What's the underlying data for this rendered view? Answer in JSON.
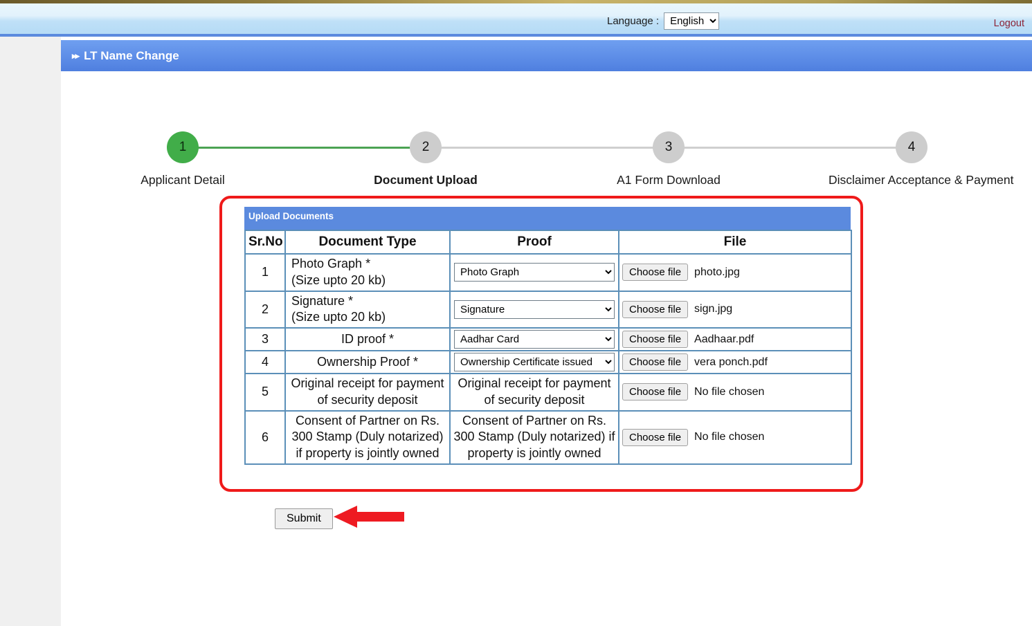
{
  "topbar": {
    "language_label": "Language :",
    "language_value": "English",
    "language_options": [
      "English"
    ],
    "logout_label": "Logout"
  },
  "page_heading": {
    "bullet": "▸▸",
    "title": "LT Name Change"
  },
  "stepper": {
    "steps": [
      {
        "number": "1",
        "label": "Applicant Detail",
        "state": "done"
      },
      {
        "number": "2",
        "label": "Document Upload",
        "state": "current"
      },
      {
        "number": "3",
        "label": "A1 Form Download",
        "state": "pending"
      },
      {
        "number": "4",
        "label": "Disclaimer Acceptance & Payment",
        "state": "pending"
      }
    ]
  },
  "upload_table": {
    "caption": "Upload Documents",
    "columns": [
      "Sr.No",
      "Document Type",
      "Proof",
      "File"
    ],
    "rows": [
      {
        "sr": "1",
        "doc_type": "Photo Graph *\n(Size upto 20 kb)",
        "doc_type_line1": "Photo Graph *",
        "doc_type_line2": "(Size upto 20 kb)",
        "proof_kind": "select",
        "proof_value": "Photo Graph",
        "choose_label": "Choose file",
        "file_name": "photo.jpg"
      },
      {
        "sr": "2",
        "doc_type_line1": "Signature *",
        "doc_type_line2": "(Size upto 20 kb)",
        "proof_kind": "select",
        "proof_value": "Signature",
        "choose_label": "Choose file",
        "file_name": "sign.jpg"
      },
      {
        "sr": "3",
        "doc_type_line1": "ID proof *",
        "doc_type_line2": "",
        "proof_kind": "select",
        "proof_value": "Aadhar Card",
        "choose_label": "Choose file",
        "file_name": "Aadhaar.pdf"
      },
      {
        "sr": "4",
        "doc_type_line1": "Ownership Proof *",
        "doc_type_line2": "",
        "proof_kind": "select",
        "proof_value": "Ownership Certificate issued",
        "choose_label": "Choose file",
        "file_name": "vera ponch.pdf"
      },
      {
        "sr": "5",
        "doc_type_line1": "Original receipt for payment of security deposit",
        "doc_type_line2": "",
        "proof_kind": "text",
        "proof_value": "Original receipt for payment of security deposit",
        "choose_label": "Choose file",
        "file_name": "No file chosen"
      },
      {
        "sr": "6",
        "doc_type_line1": "Consent of Partner on Rs. 300 Stamp (Duly notarized) if property is jointly owned",
        "doc_type_line2": "",
        "proof_kind": "text",
        "proof_value": "Consent of Partner on Rs. 300 Stamp (Duly notarized) if property is jointly owned",
        "choose_label": "Choose file",
        "file_name": "No file chosen"
      }
    ]
  },
  "footer_actions": {
    "submit_label": "Submit"
  },
  "colors": {
    "accent_blue": "#5b8ade",
    "step_done_green": "#41ad49",
    "step_pending_grey": "#cdcdcd",
    "highlight_red": "#ef1a1a",
    "logout_red": "#8c2437",
    "table_border": "#5b8fb8"
  }
}
